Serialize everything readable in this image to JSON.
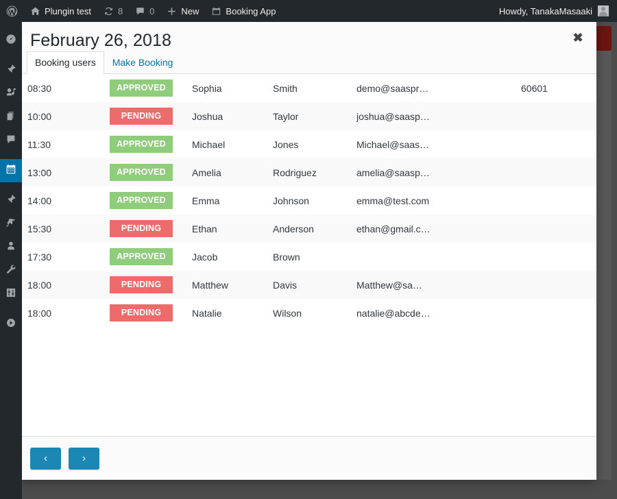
{
  "adminbar": {
    "wp_logo": "wordpress-logo",
    "items": [
      {
        "icon": "home-icon",
        "label": "Plungin test"
      },
      {
        "icon": "updates-icon",
        "label": "8"
      },
      {
        "icon": "comments-icon",
        "label": "0"
      },
      {
        "icon": "plus-icon",
        "label": "New"
      },
      {
        "icon": "calendar-icon",
        "label": "Booking App"
      }
    ],
    "account": "Howdy, TanakaMasaaki",
    "avatar": "user-avatar"
  },
  "adminmenu": {
    "items": [
      {
        "icon": "dashboard-icon",
        "current": false
      },
      {
        "icon": "posts-pin-icon",
        "current": false
      },
      {
        "icon": "media-icon",
        "current": false
      },
      {
        "icon": "pages-icon",
        "current": false
      },
      {
        "icon": "comments-icon",
        "current": false
      },
      {
        "icon": "calendar-icon",
        "current": true
      },
      {
        "icon": "appearance-brush-icon",
        "current": false
      },
      {
        "icon": "plugins-plug-icon",
        "current": false
      },
      {
        "icon": "users-icon",
        "current": false
      },
      {
        "icon": "tools-wrench-icon",
        "current": false
      },
      {
        "icon": "settings-sliders-icon",
        "current": false
      },
      {
        "icon": "collapse-play-icon",
        "current": false
      }
    ]
  },
  "modal": {
    "title": "February 26, 2018",
    "close_label": "✖",
    "tabs": [
      {
        "label": "Booking users",
        "active": true
      },
      {
        "label": "Make Booking",
        "active": false
      }
    ],
    "footer": {
      "prev_label": "‹",
      "next_label": "›"
    },
    "table": {
      "rows": [
        {
          "time": "08:30",
          "status": "APPROVED",
          "status_type": "approved",
          "first": "Sophia",
          "last": "Smith",
          "email": "demo@saaspr…",
          "zip": "60601"
        },
        {
          "time": "10:00",
          "status": "PENDING",
          "status_type": "pending",
          "first": "Joshua",
          "last": "Taylor",
          "email": "joshua@saasp…",
          "zip": ""
        },
        {
          "time": "11:30",
          "status": "APPROVED",
          "status_type": "approved",
          "first": "Michael",
          "last": "Jones",
          "email": "Michael@saas…",
          "zip": ""
        },
        {
          "time": "13:00",
          "status": "APPROVED",
          "status_type": "approved",
          "first": "Amelia",
          "last": "Rodriguez",
          "email": "amelia@saasp…",
          "zip": ""
        },
        {
          "time": "14:00",
          "status": "APPROVED",
          "status_type": "approved",
          "first": "Emma",
          "last": "Johnson",
          "email": "emma@test.com",
          "zip": ""
        },
        {
          "time": "15:30",
          "status": "PENDING",
          "status_type": "pending",
          "first": "Ethan",
          "last": "Anderson",
          "email": "ethan@gmail.c…",
          "zip": ""
        },
        {
          "time": "17:30",
          "status": "APPROVED",
          "status_type": "approved",
          "first": "Jacob",
          "last": "Brown",
          "email": "",
          "zip": ""
        },
        {
          "time": "18:00",
          "status": "PENDING",
          "status_type": "pending",
          "first": "Matthew",
          "last": "Davis",
          "email": "Matthew@sa…",
          "zip": ""
        },
        {
          "time": "18:00",
          "status": "PENDING",
          "status_type": "pending",
          "first": "Natalie",
          "last": "Wilson",
          "email": "natalie@abcde…",
          "zip": ""
        }
      ]
    }
  },
  "colors": {
    "adminbar_bg": "#23282d",
    "approved": "#8fcc7b",
    "pending": "#ee6b6b",
    "accent_blue": "#0073aa",
    "nav_button": "#1b87b5",
    "backdrop": "#4c4c4c"
  }
}
